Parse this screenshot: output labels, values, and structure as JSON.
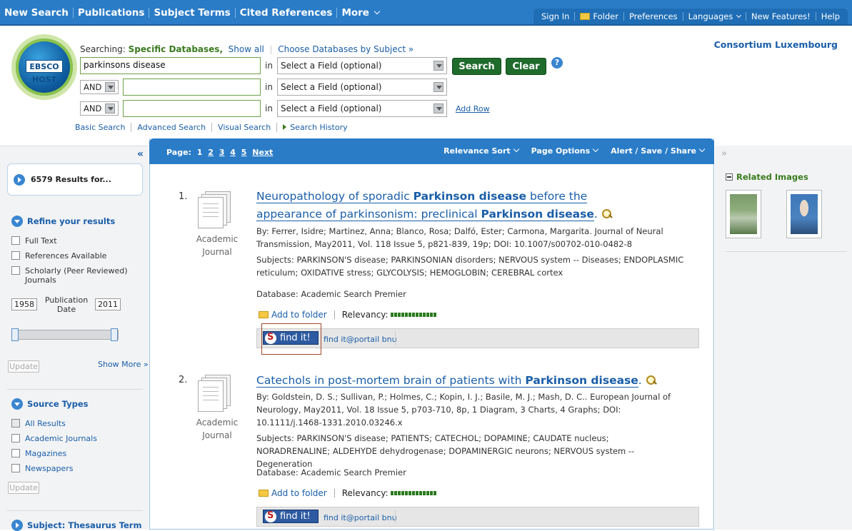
{
  "topnav": [
    "New Search",
    "Publications",
    "Subject Terms",
    "Cited References",
    "More"
  ],
  "toplinks": [
    "Sign In",
    "Folder",
    "Preferences",
    "Languages",
    "New Features!",
    "Help"
  ],
  "logo_text": "EBSCO HOST",
  "consortium": "Consortium Luxembourg",
  "searching": {
    "label": "Searching:",
    "value": "Specific Databases,",
    "show_all": "Show all",
    "choose": "Choose Databases by Subject »"
  },
  "search": {
    "query": "parkinsons disease",
    "in_label": "in",
    "field_placeholder": "Select a Field (optional)",
    "bool1": "AND",
    "bool2": "AND",
    "search_btn": "Search",
    "clear_btn": "Clear",
    "help": "?",
    "add_row": "Add Row"
  },
  "subnav": [
    "Basic Search",
    "Advanced Search",
    "Visual Search",
    "Search History"
  ],
  "left": {
    "results": "6579 Results for...",
    "refine": "Refine your results",
    "filters": [
      "Full Text",
      "References Available",
      "Scholarly (Peer Reviewed) Journals"
    ],
    "year_from": "1958",
    "year_to": "2011",
    "pub_date": "Publication Date",
    "update": "Update",
    "show_more": "Show More »",
    "source_types": "Source Types",
    "sources": [
      "All Results",
      "Academic Journals",
      "Magazines",
      "Newspapers"
    ],
    "subject": "Subject: Thesaurus Term"
  },
  "toolbar": {
    "page_label": "Page:",
    "pages": [
      "1",
      "2",
      "3",
      "4",
      "5"
    ],
    "next": "Next",
    "relevance": "Relevance Sort",
    "page_options": "Page Options",
    "alert": "Alert / Save / Share"
  },
  "results": [
    {
      "num": "1.",
      "type": "Academic Journal",
      "title_a": "Neuropathology of sporadic",
      "title_b": "Parkinson disease",
      "title_c": "before the appearance of parkinsonism: preclinical",
      "title_d": "Parkinson disease",
      "title_e": ".",
      "by": "By: Ferrer, Isidre; Martinez, Anna; Blanco, Rosa; Dalfó, Ester; Carmona, Margarita. Journal of Neural Transmission, May2011, Vol. 118 Issue 5, p821-839, 19p; DOI: 10.1007/s00702-010-0482-8",
      "subjects": "Subjects: PARKINSON'S disease; PARKINSONIAN disorders; NERVOUS system -- Diseases; ENDOPLASMIC reticulum; OXIDATIVE stress; GLYCOLYSIS; HEMOGLOBIN; CEREBRAL cortex",
      "database": "Database: Academic Search Premier",
      "add_folder": "Add to folder",
      "relevancy": "Relevancy:",
      "find_it": "find it!",
      "find_link": "find it@portail bnu"
    },
    {
      "num": "2.",
      "type": "Academic Journal",
      "title_a": "Catechols in post-mortem brain of patients with",
      "title_b": "Parkinson disease",
      "title_c": "",
      "title_d": "",
      "title_e": ".",
      "by": "By: Goldstein, D. S.; Sullivan, P.; Holmes, C.; Kopin, I. J.; Basile, M. J.; Mash, D. C.. European Journal of Neurology, May2011, Vol. 18 Issue 5, p703-710, 8p, 1 Diagram, 3 Charts, 4 Graphs; DOI: 10.1111/j.1468-1331.2010.03246.x",
      "subjects": "Subjects: PARKINSON'S disease; PATIENTS; CATECHOL; DOPAMINE; CAUDATE nucleus; NORADRENALINE; ALDEHYDE dehydrogenase; DOPAMINERGIC neurons; NERVOUS system -- Degeneration",
      "database": "Database: Academic Search Premier",
      "add_folder": "Add to folder",
      "relevancy": "Relevancy:",
      "find_it": "find it!",
      "find_link": "find it@portail bnu"
    }
  ],
  "right": {
    "related_images": "Related Images"
  }
}
